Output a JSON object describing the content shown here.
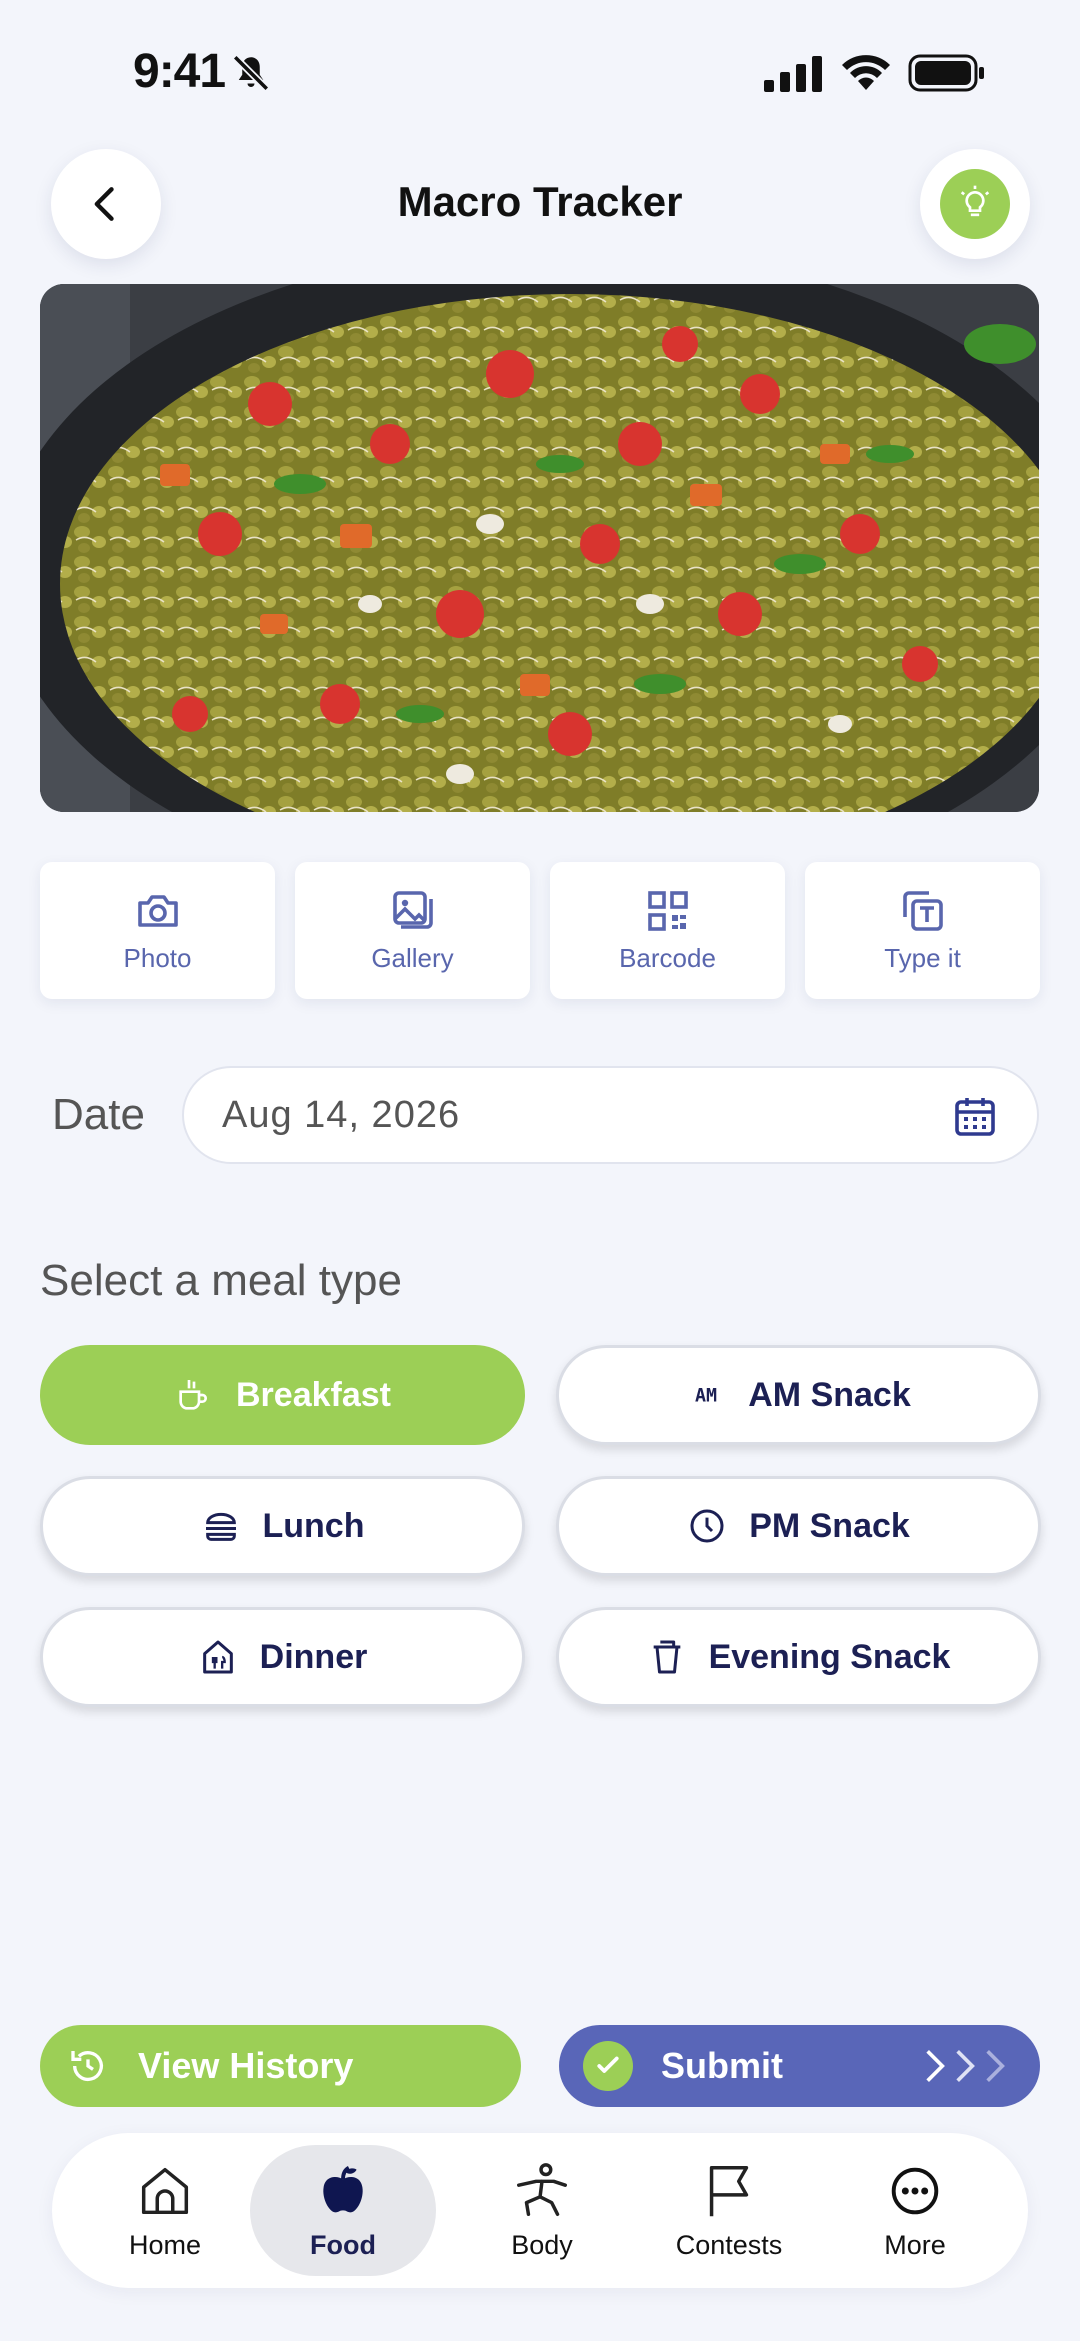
{
  "status_bar": {
    "time": "9:41"
  },
  "header": {
    "title": "Macro Tracker"
  },
  "input_methods": [
    {
      "label": "Photo",
      "icon": "camera-icon"
    },
    {
      "label": "Gallery",
      "icon": "gallery-icon"
    },
    {
      "label": "Barcode",
      "icon": "qr-code-icon"
    },
    {
      "label": "Type it",
      "icon": "text-input-icon"
    }
  ],
  "date": {
    "label": "Date",
    "value": "Aug 14, 2026"
  },
  "meal_type": {
    "heading": "Select a meal type",
    "options": [
      {
        "label": "Breakfast",
        "icon": "coffee-cup-icon",
        "selected": true
      },
      {
        "label": "AM Snack",
        "icon": "am-icon",
        "selected": false
      },
      {
        "label": "Lunch",
        "icon": "burger-icon",
        "selected": false
      },
      {
        "label": "PM Snack",
        "icon": "clock-icon",
        "selected": false
      },
      {
        "label": "Dinner",
        "icon": "restaurant-icon",
        "selected": false
      },
      {
        "label": "Evening Snack",
        "icon": "cup-icon",
        "selected": false
      }
    ]
  },
  "actions": {
    "history_label": "View History",
    "submit_label": "Submit"
  },
  "tab_bar": [
    {
      "label": "Home",
      "icon": "home-icon",
      "active": false
    },
    {
      "label": "Food",
      "icon": "apple-icon",
      "active": true
    },
    {
      "label": "Body",
      "icon": "yoga-pose-icon",
      "active": false
    },
    {
      "label": "Contests",
      "icon": "flag-icon",
      "active": false
    },
    {
      "label": "More",
      "icon": "more-icon",
      "active": false
    }
  ],
  "colors": {
    "accent_green": "#9ccf56",
    "accent_blue": "#5966b8",
    "text_navy": "#1c2054",
    "background": "#f3f5fb"
  }
}
